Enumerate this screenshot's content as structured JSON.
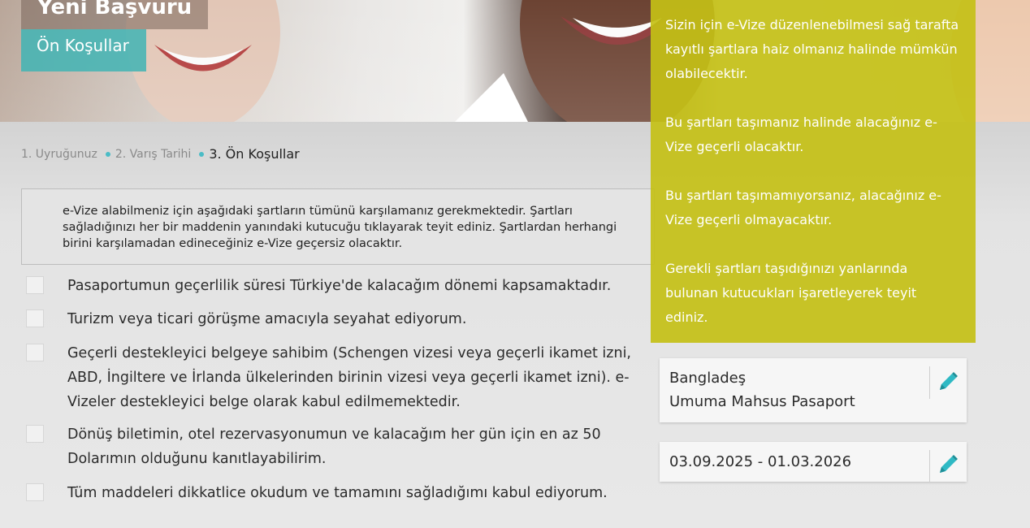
{
  "hero": {
    "title": "Yeni Başvuru",
    "subtitle": "Ön Koşullar"
  },
  "steps": [
    {
      "label": "1. Uyruğunuz"
    },
    {
      "label": "2. Varış Tarihi"
    },
    {
      "label": "3. Ön Koşullar"
    }
  ],
  "notice": "e-Vize alabilmeniz için aşağıdaki şartların tümünü karşılamanız gerekmektedir. Şartları sağladığınızı her bir maddenin yanındaki kutucuğu tıklayarak teyit ediniz. Şartlardan herhangi birini karşılamadan edineceğiniz e-Vize geçersiz olacaktır.",
  "conditions": [
    {
      "text": "Pasaportumun geçerlilik süresi Türkiye'de kalacağım dönemi kapsamaktadır.",
      "checked": false
    },
    {
      "text": "Turizm veya ticari görüşme amacıyla seyahat ediyorum.",
      "checked": false
    },
    {
      "text": "Geçerli destekleyici belgeye sahibim (Schengen vizesi veya geçerli ikamet izni, ABD, İngiltere ve İrlanda ülkelerinden birinin vizesi veya geçerli ikamet izni). e-Vizeler destekleyici belge olarak kabul edilmemektedir.",
      "checked": false
    },
    {
      "text": "Dönüş biletimin, otel rezervasyonumun ve kalacağım her gün için en az 50 Dolarımın olduğunu kanıtlayabilirim.",
      "checked": false
    },
    {
      "text": "Tüm maddeleri dikkatlice okudum ve tamamını sağladığımı kabul ediyorum.",
      "checked": false
    }
  ],
  "info_panel": {
    "paragraphs": [
      "Sizin için e-Vize düzenlenebilmesi sağ tarafta kayıtlı şartlara haiz olmanız halinde mümkün olabilecektir.",
      "Bu şartları taşımanız halinde alacağınız e-Vize geçerli olacaktır.",
      "Bu şartları taşımamıyorsanız, alacağınız e-Vize geçerli olmayacaktır.",
      "Gerekli şartları taşıdığınızı yanlarında bulunan kutucukları işaretleyerek teyit ediniz."
    ]
  },
  "summary": {
    "nationality": "Bangladeş",
    "passport_type": "Umuma Mahsus Pasaport",
    "dates": "03.09.2025 - 01.03.2026"
  },
  "colors": {
    "accent_teal": "#4bbcc6",
    "panel_yellow": "#c4c016",
    "subtitle_teal": "#41b4b4"
  },
  "icons": {
    "edit": "pencil-icon"
  }
}
